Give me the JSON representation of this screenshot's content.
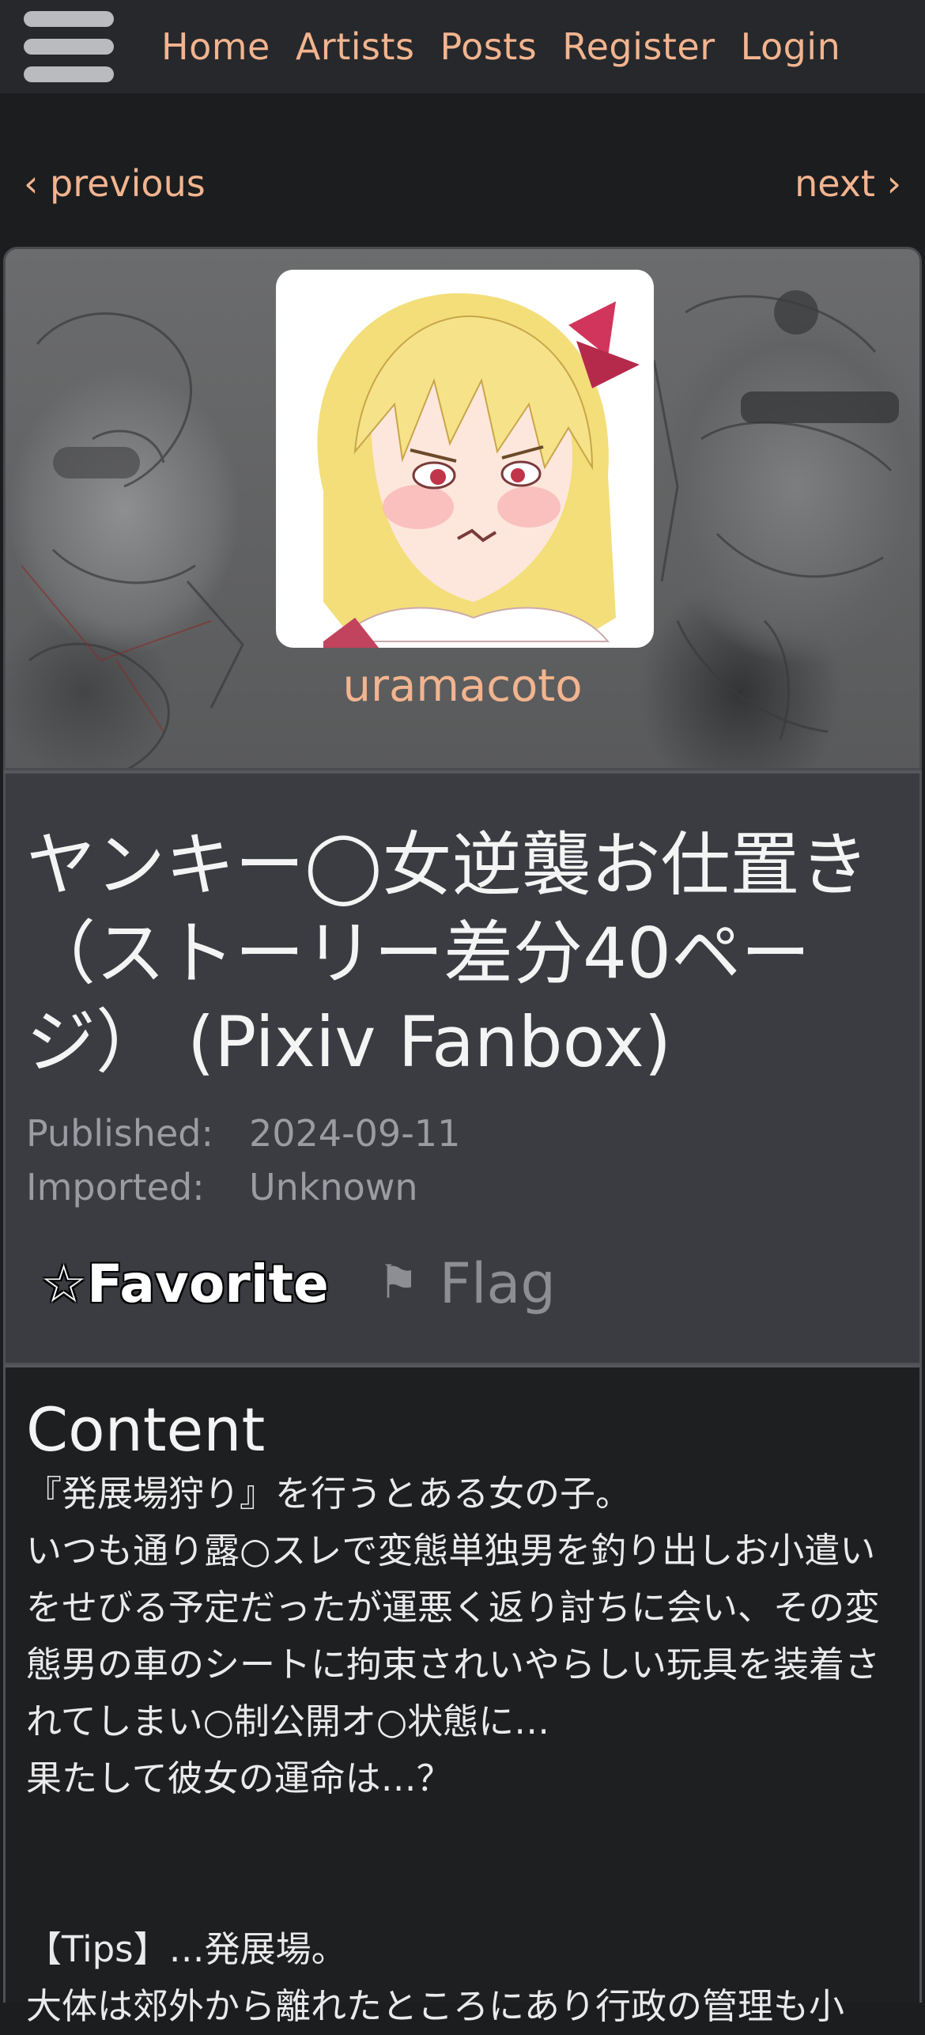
{
  "nav": {
    "items": [
      "Home",
      "Artists",
      "Posts",
      "Register",
      "Login"
    ]
  },
  "pager": {
    "previous": "‹ previous",
    "next": "next ›"
  },
  "artist": {
    "name": "uramacoto"
  },
  "post": {
    "title": "ヤンキー◯女逆襲お仕置き（ストーリー差分40ページ） (Pixiv Fanbox)",
    "published_label": "Published:",
    "published_value": "2024-09-11",
    "imported_label": "Imported:",
    "imported_value": "Unknown",
    "favorite_label": "☆Favorite",
    "flag_icon": "⚑",
    "flag_label": "Flag"
  },
  "content": {
    "heading": "Content",
    "lines": [
      "『発展場狩り』を行うとある女の子。",
      "いつも通り露○スレで変態単独男を釣り出しお小遣いをせびる予定だったが運悪く返り討ちに会い、その変態男の車のシートに拘束されいやらしい玩具を装着されてしまい○制公開オ○状態に…",
      "果たして彼女の運命は…？",
      "【Tips】…発展場。",
      "大体は郊外から離れたところにあり行政の管理も小"
    ]
  },
  "colors": {
    "link": "#f2b48f",
    "nav_bg": "#27282b",
    "page_bg": "#1c1d1f",
    "header_bg": "#3a3c42"
  }
}
